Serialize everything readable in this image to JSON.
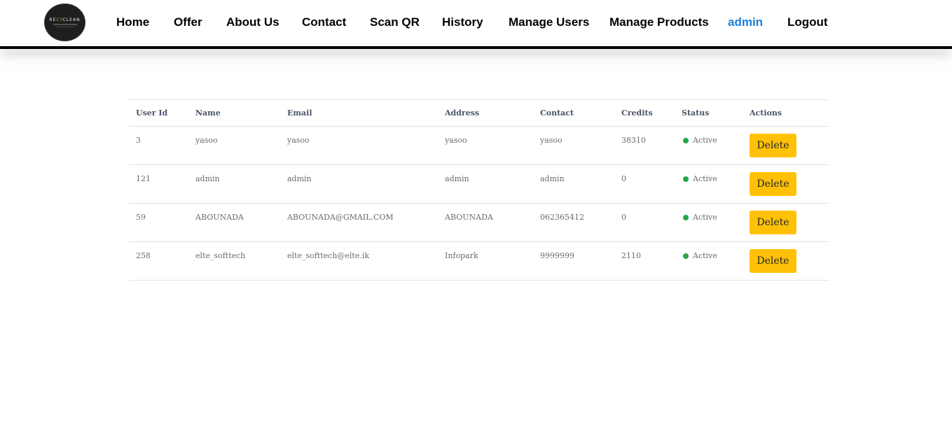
{
  "brand": {
    "logo_text": "RECYCLEAN"
  },
  "nav": {
    "home": "Home",
    "offer": "Offer",
    "about": "About Us",
    "contact": "Contact",
    "scan_qr": "Scan QR",
    "history": "History",
    "manage_users": "Manage Users",
    "manage_products": "Manage Products",
    "current_user": "admin",
    "logout": "Logout"
  },
  "colors": {
    "active_nav": "#1a7fd6",
    "delete_button": "#ffc107",
    "status_active": "#28a745"
  },
  "table": {
    "headers": {
      "user_id": "User Id",
      "name": "Name",
      "email": "Email",
      "address": "Address",
      "contact": "Contact",
      "credits": "Credits",
      "status": "Status",
      "actions": "Actions"
    },
    "rows": [
      {
        "user_id": "3",
        "name": "yasoo",
        "email": "yasoo",
        "address": "yasoo",
        "contact": "yasoo",
        "credits": "38310",
        "status": "Active",
        "action": "Delete"
      },
      {
        "user_id": "121",
        "name": "admin",
        "email": "admin",
        "address": "admin",
        "contact": "admin",
        "credits": "0",
        "status": "Active",
        "action": "Delete"
      },
      {
        "user_id": "59",
        "name": "ABOUNADA",
        "email": "ABOUNADA@GMAIL.COM",
        "address": "ABOUNADA",
        "contact": "062365412",
        "credits": "0",
        "status": "Active",
        "action": "Delete"
      },
      {
        "user_id": "258",
        "name": "elte_softtech",
        "email": "elte_softtech@elte.ik",
        "address": "Infopark",
        "contact": "9999999",
        "credits": "2110",
        "status": "Active",
        "action": "Delete"
      }
    ]
  }
}
